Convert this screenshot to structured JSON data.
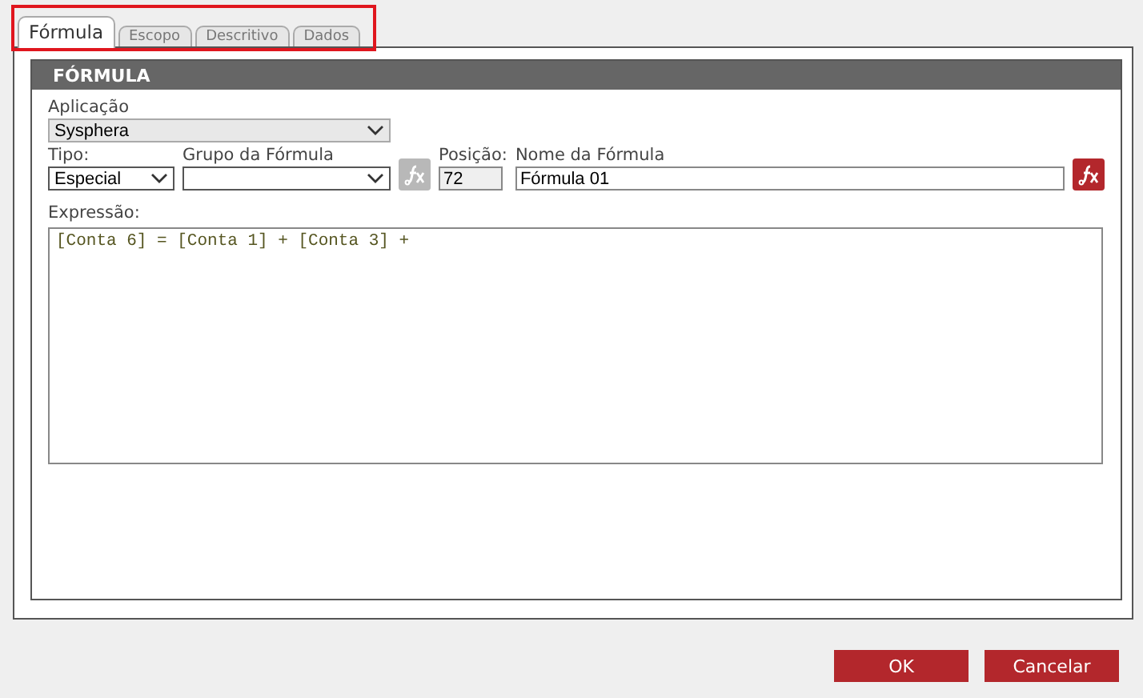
{
  "tabs": [
    {
      "label": "Fórmula",
      "selected": true
    },
    {
      "label": "Escopo",
      "selected": false
    },
    {
      "label": "Descritivo",
      "selected": false
    },
    {
      "label": "Dados",
      "selected": false
    }
  ],
  "section": {
    "title": "FÓRMULA"
  },
  "application": {
    "label": "Aplicação",
    "value": "Sysphera"
  },
  "type": {
    "label": "Tipo:",
    "value": "Especial"
  },
  "formula_group": {
    "label": "Grupo da Fórmula"
  },
  "group_button": {
    "disabled": true
  },
  "position": {
    "label": "Posição:",
    "value": "72"
  },
  "formula_name": {
    "label": "Nome da Fórmula",
    "value": "Fórmula 01"
  },
  "expression": {
    "label": "Expressão:",
    "value": "[Conta 6] = [Conta 1] + [Conta 3] +"
  },
  "buttons": [
    "OK",
    "Cancelar"
  ]
}
